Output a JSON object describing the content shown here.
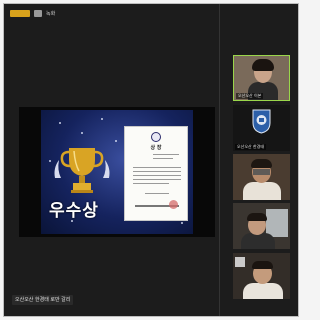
{
  "topbar": {
    "meeting_label": "녹화",
    "right_label": ""
  },
  "main": {
    "slide": {
      "award_text": "우수상",
      "certificate": {
        "title": "상 장"
      }
    },
    "speaker_name": "오산오산 한경태 로만 갈리"
  },
  "participants": [
    {
      "label": "오산오산 이본"
    },
    {
      "label": "오산오산 한경태"
    },
    {
      "label": ""
    },
    {
      "label": ""
    },
    {
      "label": ""
    }
  ],
  "colors": {
    "active_speaker_border": "#9ad64b",
    "slide_bg": "#15235e"
  }
}
